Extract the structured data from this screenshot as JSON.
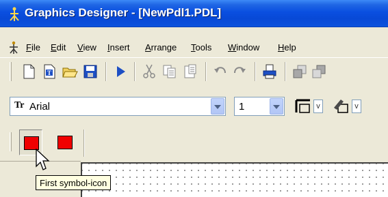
{
  "window": {
    "title": "Graphics Designer - [NewPdl1.PDL]"
  },
  "menu": {
    "items": [
      {
        "accel": "F",
        "rest": "ile"
      },
      {
        "accel": "E",
        "rest": "dit"
      },
      {
        "accel": "V",
        "rest": "iew"
      },
      {
        "accel": "I",
        "rest": "nsert"
      },
      {
        "accel": "A",
        "rest": "rrange"
      },
      {
        "accel": "T",
        "rest": "ools"
      },
      {
        "accel": "W",
        "rest": "indow"
      },
      {
        "accel": "H",
        "rest": "elp"
      }
    ]
  },
  "toolbar": {
    "icons": [
      "new-document-icon",
      "new-template-icon",
      "open-folder-icon",
      "save-icon",
      "run-icon",
      "cut-icon",
      "copy-icon",
      "paste-icon",
      "undo-icon",
      "redo-icon",
      "print-icon",
      "arrange-front-icon",
      "arrange-back-icon"
    ]
  },
  "format_bar": {
    "font_icon_text": "Tr",
    "font_value": "Arial",
    "size_value": "1",
    "line_dropdown_letter": "v",
    "fill_dropdown_letter": "v"
  },
  "symbols": {
    "colors": {
      "symbol_fill": "#f00000"
    }
  },
  "tooltip": {
    "text": "First symbol-icon"
  }
}
